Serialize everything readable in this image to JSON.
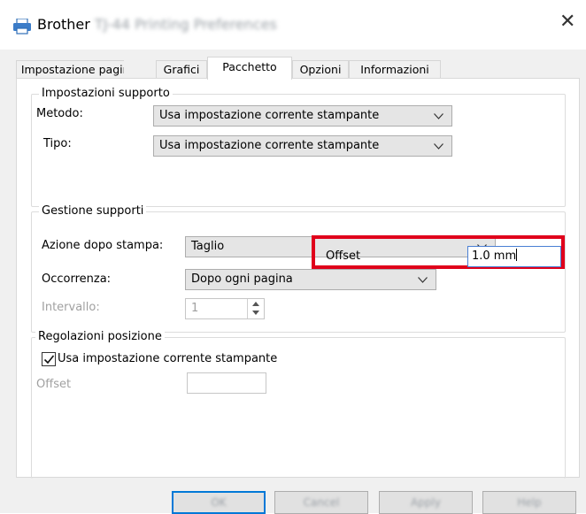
{
  "window": {
    "title_brand": "Brother",
    "title_rest": "TJ-44 Printing Preferences"
  },
  "tabs": [
    "Impostazione pagina",
    "Grafici",
    "Pacchetto",
    "Opzioni",
    "Informazioni"
  ],
  "active_tab": "Pacchetto",
  "supporto": {
    "title": "Impostazioni supporto",
    "metodo_label": "Metodo:",
    "metodo_value": "Usa impostazione corrente stampante",
    "tipo_label": "Tipo:",
    "tipo_value": "Usa impostazione corrente stampante"
  },
  "gestione": {
    "title": "Gestione supporti",
    "azione_label": "Azione dopo stampa:",
    "azione_value": "Taglio",
    "occorrenza_label": "Occorrenza:",
    "occorrenza_value": "Dopo ogni pagina",
    "intervallo_label": "Intervallo:",
    "intervallo_value": "1",
    "offset_label": "Offset",
    "offset_value": "1.0 mm"
  },
  "posizione": {
    "title": "Regolazioni posizione",
    "checkbox_label": "Usa impostazione corrente stampante",
    "checkbox_checked": true,
    "offset_label": "Offset",
    "offset_value": ""
  },
  "buttons": {
    "ok": "OK",
    "cancel": "Cancel",
    "apply": "Apply",
    "help": "Help"
  },
  "colors": {
    "highlight": "#e0001b",
    "focus": "#0078d7"
  }
}
